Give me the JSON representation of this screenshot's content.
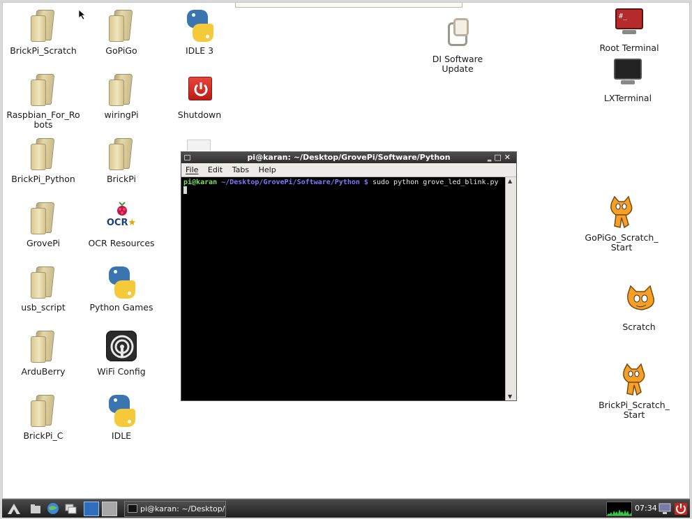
{
  "desktop": {
    "icons": [
      {
        "label": "BrickPi_Scratch",
        "icon": "folder-icon"
      },
      {
        "label": "GoPiGo",
        "icon": "folder-icon"
      },
      {
        "label": "IDLE 3",
        "icon": "python-icon"
      },
      {
        "label": "DI Software Update",
        "icon": "update-icon"
      },
      {
        "label": "Root Terminal",
        "icon": "terminal-icon"
      },
      {
        "label": "Raspbian_For_Robots",
        "icon": "folder-icon"
      },
      {
        "label": "wiringPi",
        "icon": "folder-icon"
      },
      {
        "label": "Shutdown",
        "icon": "power-icon"
      },
      {
        "label": "LXTerminal",
        "icon": "terminal-icon"
      },
      {
        "label": "BrickPi_Python",
        "icon": "folder-icon"
      },
      {
        "label": "BrickPi",
        "icon": "folder-icon"
      },
      {
        "label": "GrovePi",
        "icon": "folder-icon"
      },
      {
        "label": "OCR Resources",
        "icon": "raspberry-icon"
      },
      {
        "label": "GoPiGo_Scratch_Start",
        "icon": "scratch-cat-icon"
      },
      {
        "label": "usb_script",
        "icon": "folder-icon"
      },
      {
        "label": "Python Games",
        "icon": "python-icon"
      },
      {
        "label": "Scratch",
        "icon": "scratch-cat-icon"
      },
      {
        "label": "ArduBerry",
        "icon": "folder-icon"
      },
      {
        "label": "WiFi Config",
        "icon": "wifi-icon"
      },
      {
        "label": "BrickPi_Scratch_Start",
        "icon": "scratch-cat-icon"
      },
      {
        "label": "BrickPi_C",
        "icon": "folder-icon"
      },
      {
        "label": "IDLE",
        "icon": "python-icon"
      }
    ]
  },
  "terminal": {
    "title": "pi@karan: ~/Desktop/GrovePi/Software/Python",
    "menu": [
      "File",
      "Edit",
      "Tabs",
      "Help"
    ],
    "prompt_user": "pi@karan",
    "prompt_path": "~/Desktop/GrovePi/Software/Python $",
    "command": "sudo python grove_led_blink.py"
  },
  "taskbar": {
    "task_label": "pi@karan: ~/Desktop/G...",
    "clock": "07:34"
  },
  "colors": {
    "prompt_user": "#7ee25b",
    "prompt_path": "#7a7afc",
    "terminal_bg": "#000000"
  }
}
